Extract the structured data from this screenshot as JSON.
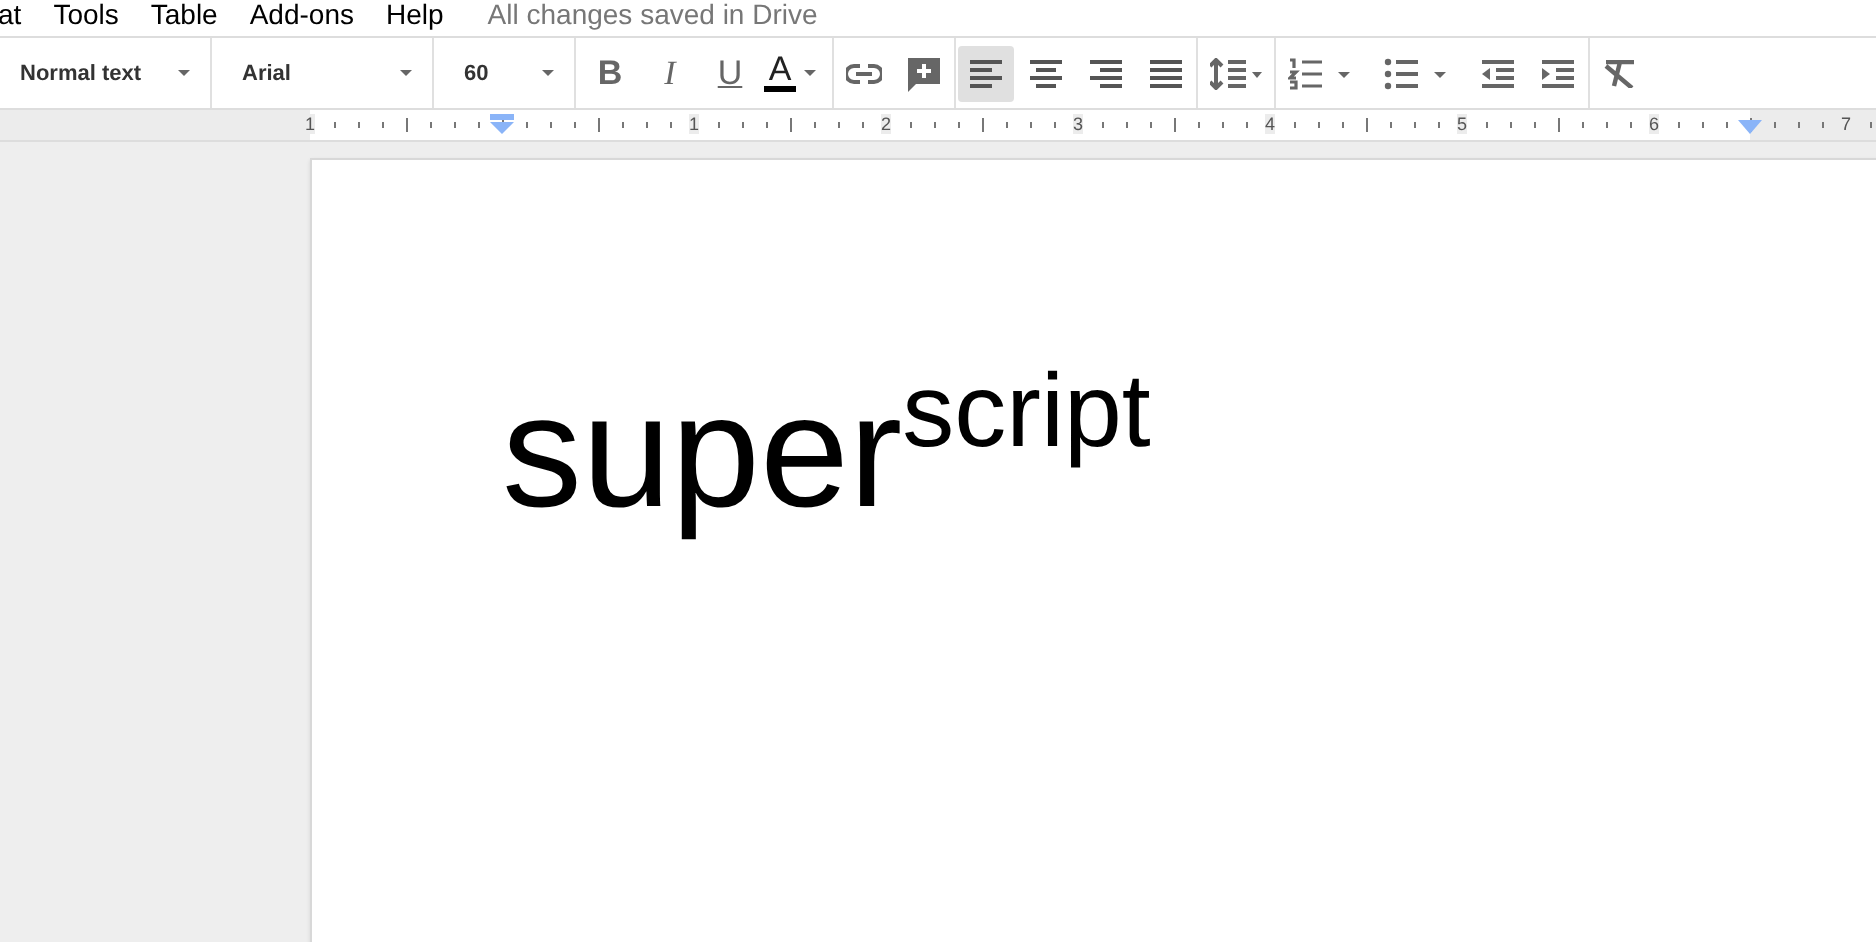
{
  "menu": [
    "at",
    "Tools",
    "Table",
    "Add-ons",
    "Help"
  ],
  "save_status": "All changes saved in Drive",
  "toolbar": {
    "dropdowns": [
      {
        "kind": "style",
        "value": "Normal text"
      },
      {
        "kind": "font",
        "value": "Arial"
      },
      {
        "kind": "size",
        "value": "60"
      }
    ],
    "format_buttons": [
      {
        "kind": "bold",
        "label": "B"
      },
      {
        "kind": "italic",
        "label": "I"
      },
      {
        "kind": "underline",
        "label": "U"
      },
      {
        "kind": "color",
        "label": "A"
      }
    ],
    "alignment": [
      {
        "kind": "left",
        "selected": true
      },
      {
        "kind": "center",
        "selected": false
      },
      {
        "kind": "right",
        "selected": false
      },
      {
        "kind": "justify",
        "selected": false
      }
    ]
  },
  "ruler": {
    "labels": [
      "1",
      "1",
      "2",
      "3",
      "4",
      "5",
      "6",
      "7"
    ]
  },
  "document": {
    "text": "super$^{script}$"
  }
}
